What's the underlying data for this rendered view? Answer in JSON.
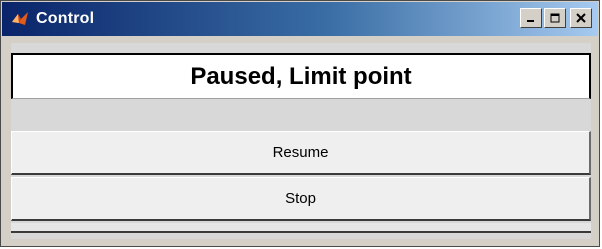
{
  "window": {
    "title": "Control",
    "icon": "matlab-icon",
    "controls": [
      "minimize-icon",
      "maximize-icon",
      "close-icon"
    ]
  },
  "status": {
    "text": "Paused, Limit point"
  },
  "buttons": {
    "resume_label": "Resume",
    "stop_label": "Stop"
  },
  "colors": {
    "titlebar_start": "#0a246a",
    "titlebar_end": "#a6caf0",
    "client_bg": "#d8d8d8",
    "button_bg": "#efefef"
  }
}
